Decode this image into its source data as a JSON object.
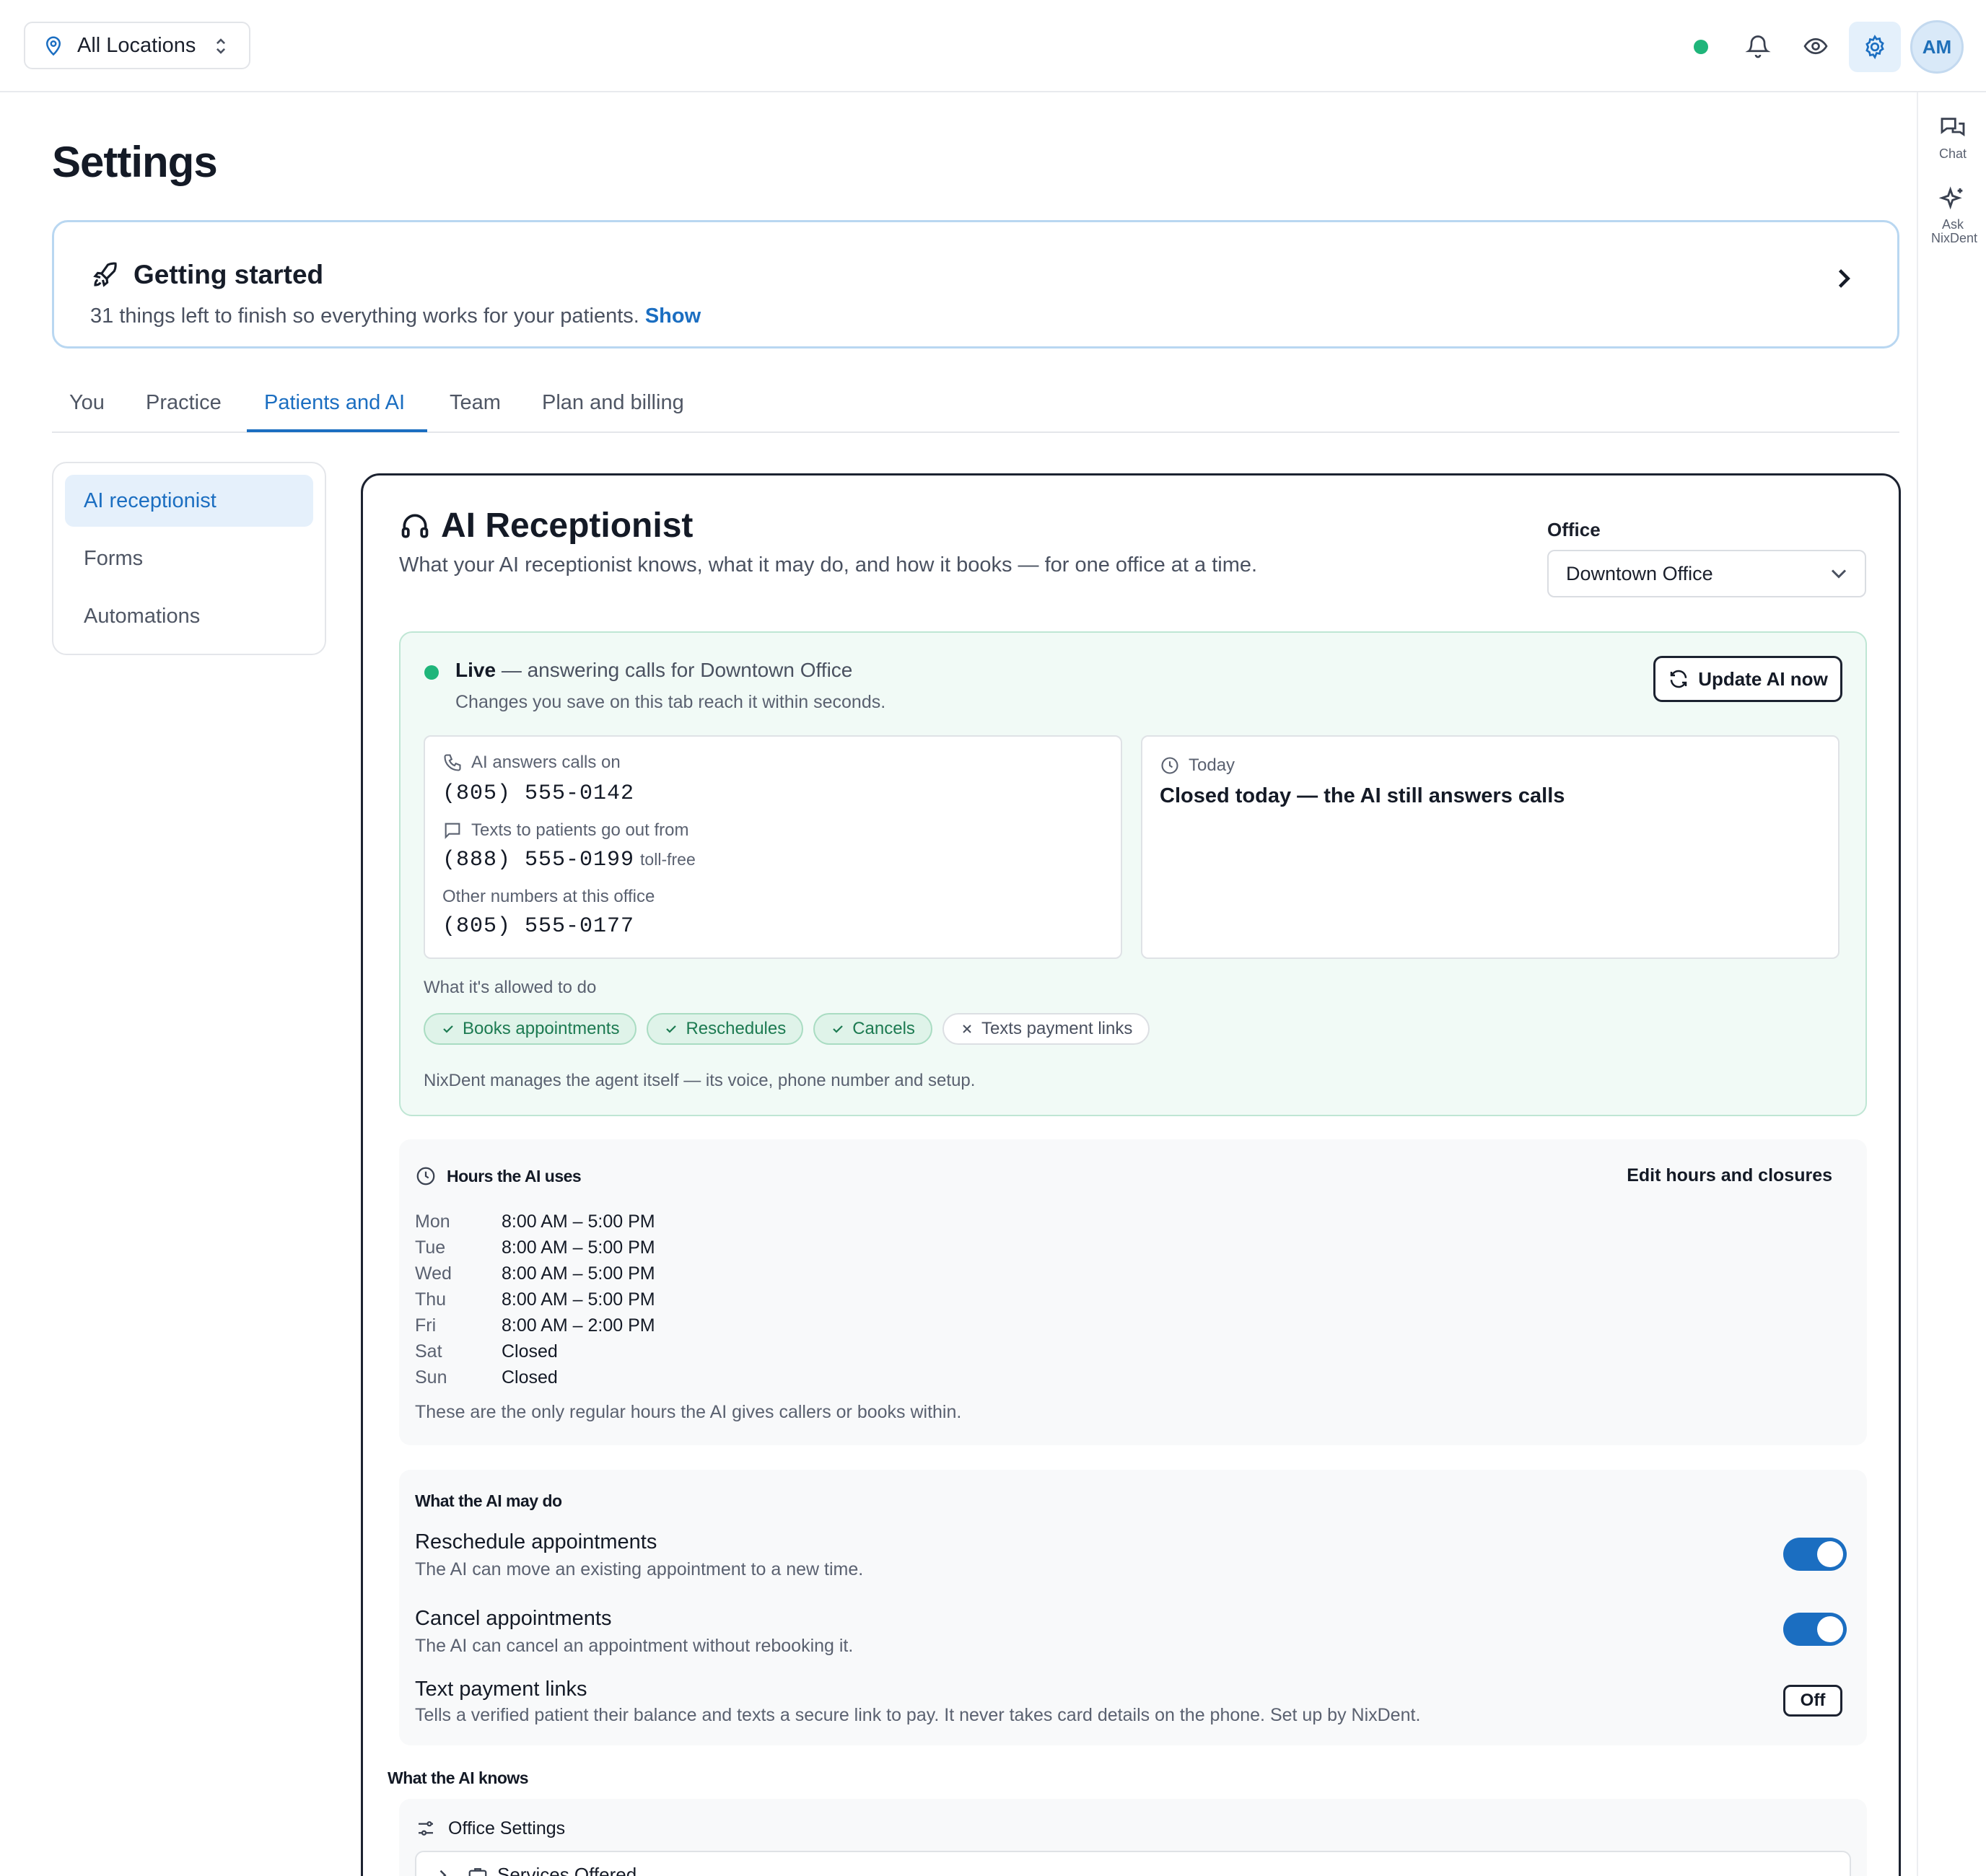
{
  "topbar": {
    "location": "All Locations",
    "avatar_initials": "AM",
    "status_color": "#1fb57a",
    "icons": [
      "map-pin-icon",
      "bell-icon",
      "eye-icon",
      "gear-icon"
    ]
  },
  "rail": {
    "chat_label": "Chat",
    "ask_label": "Ask NixDent"
  },
  "page_title": "Settings",
  "getting_started": {
    "title": "Getting started",
    "subtitle": "31 things left to finish so everything works for your patients.",
    "show_link": "Show"
  },
  "tabs": [
    "You",
    "Practice",
    "Patients and AI",
    "Team",
    "Plan and billing"
  ],
  "active_tab": "Patients and AI",
  "subnav": [
    "AI receptionist",
    "Forms",
    "Automations"
  ],
  "active_subnav": "AI receptionist",
  "receptionist": {
    "title": "AI Receptionist",
    "subtitle": "What your AI receptionist knows, what it may do, and how it books — for one office at a time.",
    "office_label": "Office",
    "office_value": "Downtown Office",
    "live": {
      "status": "Live",
      "status_detail": "— answering calls for Downtown Office",
      "sub": "Changes you save on this tab reach it within seconds.",
      "update_button": "Update AI now",
      "answers_label": "AI answers calls on",
      "answers_number": "(805) 555-0142",
      "texts_label": "Texts to patients go out from",
      "texts_number": "(888) 555-0199",
      "texts_tag": "toll-free",
      "other_label": "Other numbers at this office",
      "other_number": "(805) 555-0177",
      "today_label": "Today",
      "today_text": "Closed today — the AI still answers calls",
      "allowed_label": "What it's allowed to do",
      "chips": [
        {
          "label": "Books appointments",
          "enabled": true
        },
        {
          "label": "Reschedules",
          "enabled": true
        },
        {
          "label": "Cancels",
          "enabled": true
        },
        {
          "label": "Texts payment links",
          "enabled": false
        }
      ],
      "footnote": "NixDent manages the agent itself — its voice, phone number and setup."
    },
    "hours": {
      "title": "Hours the AI uses",
      "edit_link": "Edit hours and closures",
      "rows": [
        {
          "day": "Mon",
          "time": "8:00 AM – 5:00 PM"
        },
        {
          "day": "Tue",
          "time": "8:00 AM – 5:00 PM"
        },
        {
          "day": "Wed",
          "time": "8:00 AM – 5:00 PM"
        },
        {
          "day": "Thu",
          "time": "8:00 AM – 5:00 PM"
        },
        {
          "day": "Fri",
          "time": "8:00 AM – 2:00 PM"
        },
        {
          "day": "Sat",
          "time": "Closed"
        },
        {
          "day": "Sun",
          "time": "Closed"
        }
      ],
      "footnote": "These are the only regular hours the AI gives callers or books within."
    },
    "may_do": {
      "title": "What the AI may do",
      "items": [
        {
          "title": "Reschedule appointments",
          "desc": "The AI can move an existing appointment to a new time.",
          "state": "on"
        },
        {
          "title": "Cancel appointments",
          "desc": "The AI can cancel an appointment without rebooking it.",
          "state": "on"
        },
        {
          "title": "Text payment links",
          "desc": "Tells a verified patient their balance and texts a secure link to pay. It never takes card details on the phone. Set up by NixDent.",
          "state": "Off"
        }
      ]
    },
    "knows": {
      "title": "What the AI knows",
      "section": "Office Settings",
      "first_item": "Services Offered"
    }
  },
  "colors": {
    "accent": "#1b6ec1",
    "live_green": "#1fb57a",
    "live_bg": "#f1faf6"
  }
}
